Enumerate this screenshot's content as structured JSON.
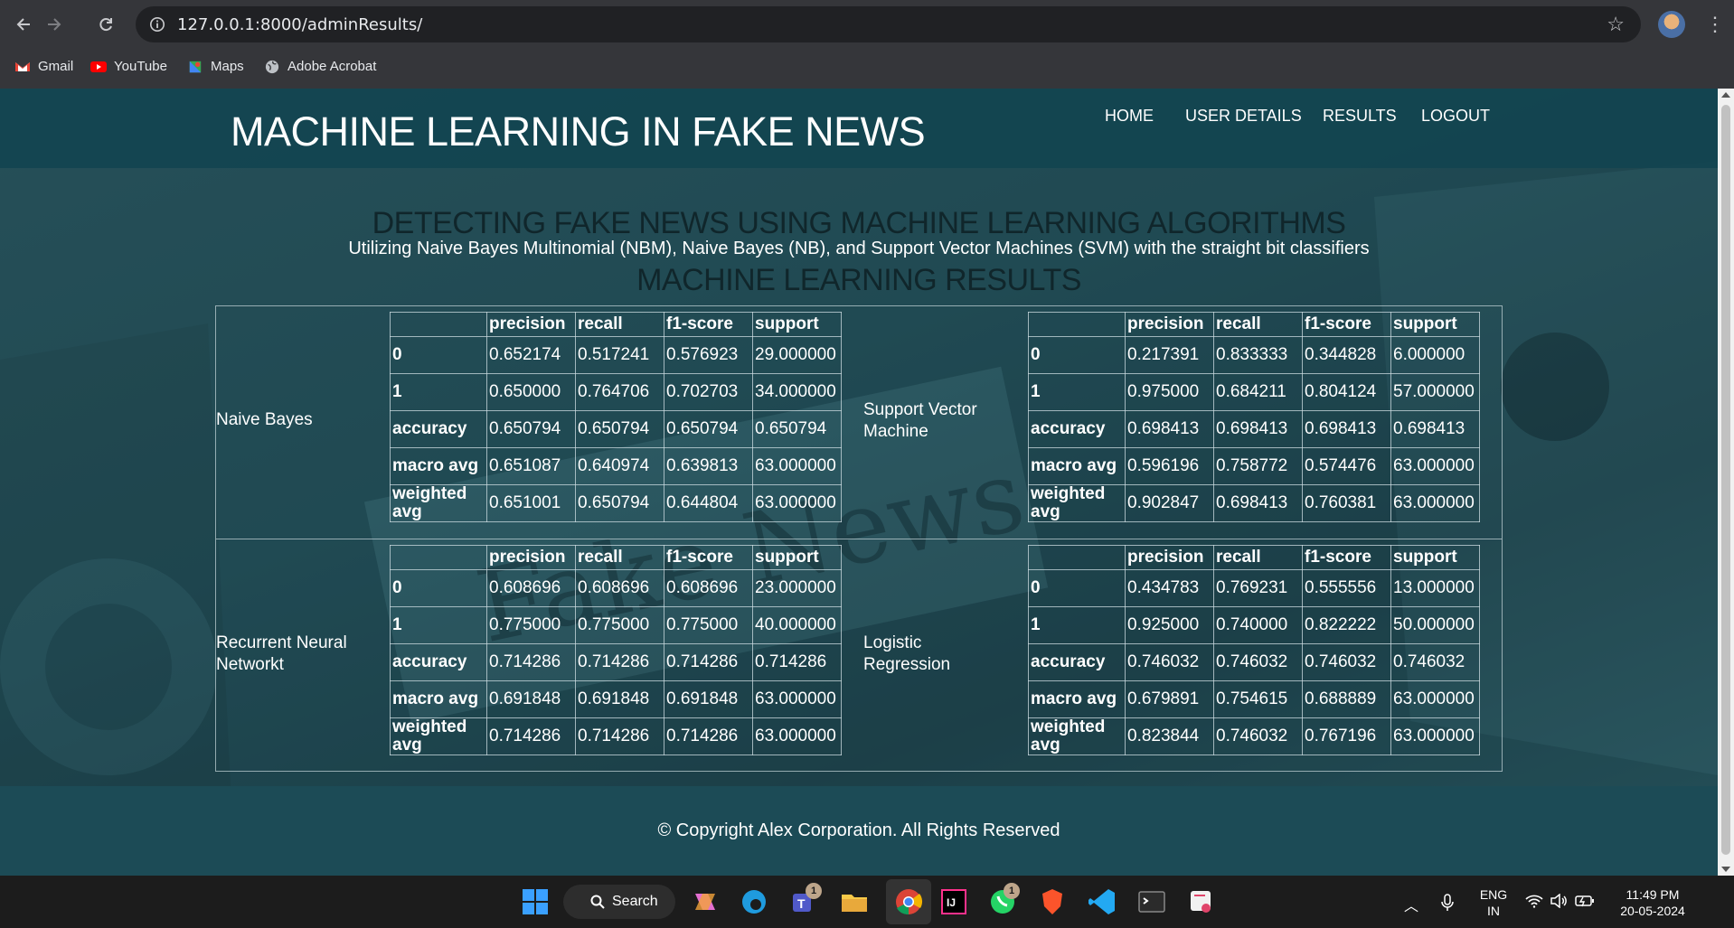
{
  "browser": {
    "url": "127.0.0.1:8000/adminResults/",
    "bookmarks": [
      "Gmail",
      "YouTube",
      "Maps",
      "Adobe Acrobat"
    ]
  },
  "site": {
    "title": "MACHINE LEARNING IN FAKE NEWS",
    "menu": [
      "HOME",
      "USER DETAILS",
      "RESULTS",
      "LOGOUT"
    ]
  },
  "hero": {
    "heading": "DETECTING FAKE NEWS USING MACHINE LEARNING ALGORITHMS",
    "subheading": "Utilizing Naive Bayes Multinomial (NBM), Naive Bayes (NB), and Support Vector Machines (SVM) with the straight bit classifiers",
    "results_heading": "MACHINE LEARNING RESULTS"
  },
  "report_headers": [
    "",
    "precision",
    "recall",
    "f1-score",
    "support"
  ],
  "models": [
    {
      "name": "Naive Bayes",
      "rows": [
        [
          "0",
          "0.652174",
          "0.517241",
          "0.576923",
          "29.000000"
        ],
        [
          "1",
          "0.650000",
          "0.764706",
          "0.702703",
          "34.000000"
        ],
        [
          "accuracy",
          "0.650794",
          "0.650794",
          "0.650794",
          "0.650794"
        ],
        [
          "macro avg",
          "0.651087",
          "0.640974",
          "0.639813",
          "63.000000"
        ],
        [
          "weighted avg",
          "0.651001",
          "0.650794",
          "0.644804",
          "63.000000"
        ]
      ]
    },
    {
      "name": "Support Vector Machine",
      "rows": [
        [
          "0",
          "0.217391",
          "0.833333",
          "0.344828",
          "6.000000"
        ],
        [
          "1",
          "0.975000",
          "0.684211",
          "0.804124",
          "57.000000"
        ],
        [
          "accuracy",
          "0.698413",
          "0.698413",
          "0.698413",
          "0.698413"
        ],
        [
          "macro avg",
          "0.596196",
          "0.758772",
          "0.574476",
          "63.000000"
        ],
        [
          "weighted avg",
          "0.902847",
          "0.698413",
          "0.760381",
          "63.000000"
        ]
      ]
    },
    {
      "name": "Recurrent Neural Networkt",
      "rows": [
        [
          "0",
          "0.608696",
          "0.608696",
          "0.608696",
          "23.000000"
        ],
        [
          "1",
          "0.775000",
          "0.775000",
          "0.775000",
          "40.000000"
        ],
        [
          "accuracy",
          "0.714286",
          "0.714286",
          "0.714286",
          "0.714286"
        ],
        [
          "macro avg",
          "0.691848",
          "0.691848",
          "0.691848",
          "63.000000"
        ],
        [
          "weighted avg",
          "0.714286",
          "0.714286",
          "0.714286",
          "63.000000"
        ]
      ]
    },
    {
      "name": "Logistic Regression",
      "rows": [
        [
          "0",
          "0.434783",
          "0.769231",
          "0.555556",
          "13.000000"
        ],
        [
          "1",
          "0.925000",
          "0.740000",
          "0.822222",
          "50.000000"
        ],
        [
          "accuracy",
          "0.746032",
          "0.746032",
          "0.746032",
          "0.746032"
        ],
        [
          "macro avg",
          "0.679891",
          "0.754615",
          "0.688889",
          "63.000000"
        ],
        [
          "weighted avg",
          "0.823844",
          "0.746032",
          "0.767196",
          "63.000000"
        ]
      ]
    }
  ],
  "footer": {
    "copyright": "© Copyright Alex Corporation. All Rights Reserved"
  },
  "taskbar": {
    "search_label": "Search",
    "teams_badge": "1",
    "whatsapp_badge": "1",
    "language": "ENG",
    "region": "IN",
    "time": "11:49 PM",
    "date": "20-05-2024"
  }
}
